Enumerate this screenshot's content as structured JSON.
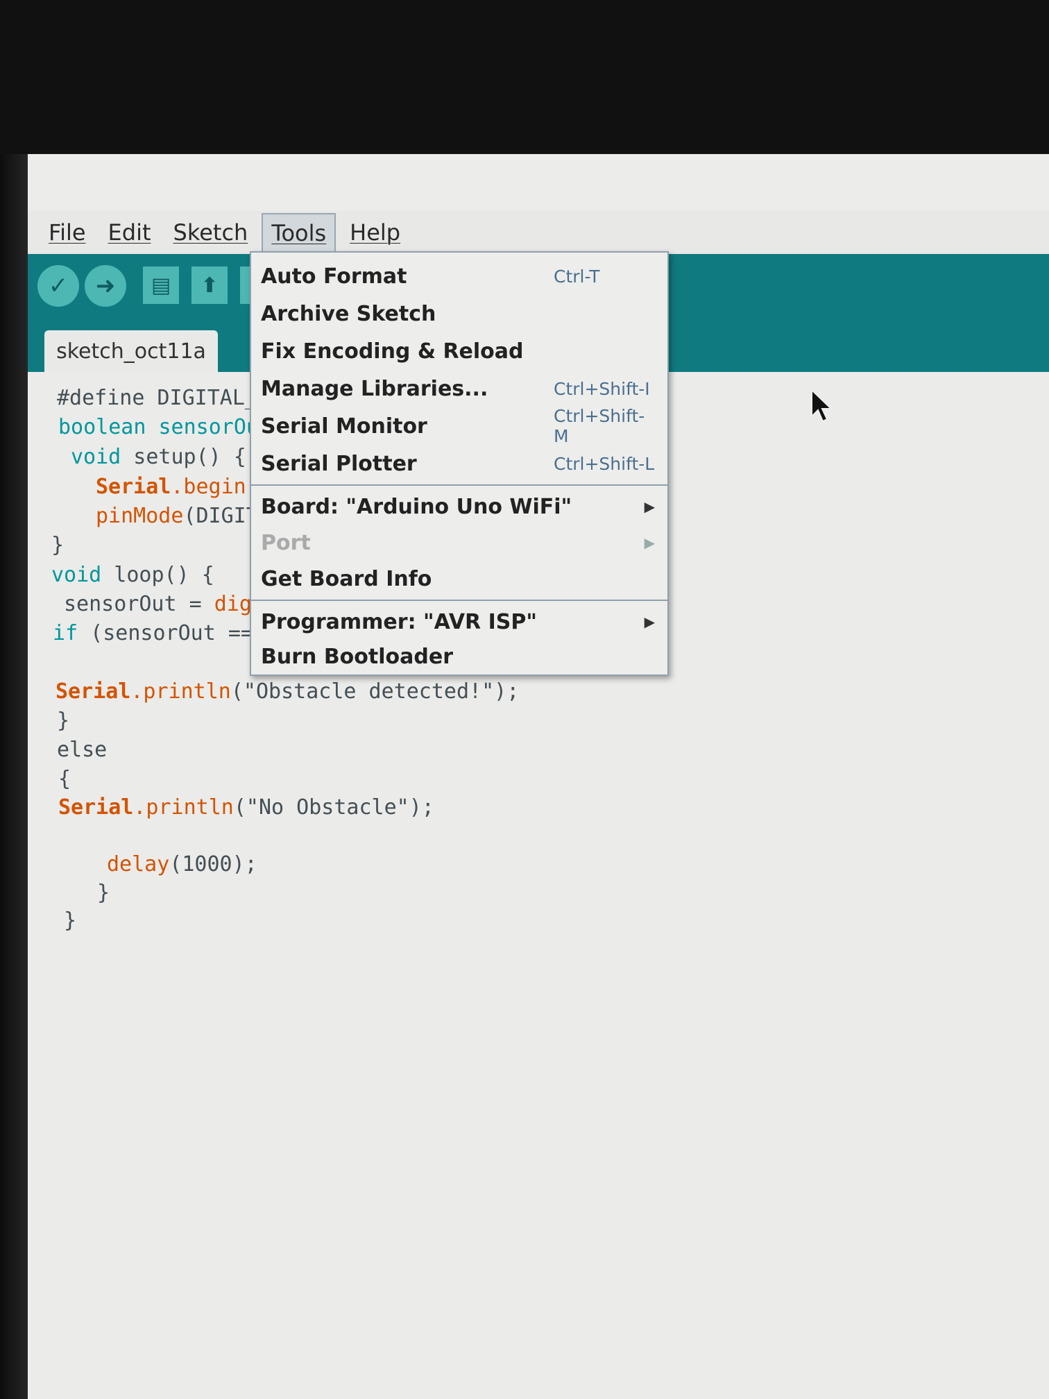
{
  "menubar": {
    "items": [
      {
        "label": "File"
      },
      {
        "label": "Edit"
      },
      {
        "label": "Sketch"
      },
      {
        "label": "Tools",
        "active": true
      },
      {
        "label": "Help"
      }
    ]
  },
  "toolbar": {
    "buttons": [
      {
        "name": "verify-icon"
      },
      {
        "name": "upload-icon"
      },
      {
        "name": "new-icon"
      },
      {
        "name": "open-icon"
      },
      {
        "name": "save-icon"
      }
    ]
  },
  "tab": {
    "label": "sketch_oct11a"
  },
  "code": {
    "line1": "#define DIGITAL_",
    "line2": "boolean sensorOu",
    "line3_a": "void",
    "line3_b": " setup() {",
    "line4_a": "Serial",
    "line4_b": ".begin(",
    "line5_a": "pinMode",
    "line5_b": "(DIGIT",
    "line6": "}",
    "line7_a": "void",
    "line7_b": " loop() {",
    "line8_a": "sensorOut = ",
    "line8_b": "digi",
    "line9_a": "if",
    "line9_b": " (sensorOut ==",
    "line10_a": "Serial",
    "line10_b": ".println",
    "line10_c": "(\"Obstacle detected!\");",
    "line11": "}",
    "line12": "else",
    "line13": "{",
    "line14_a": "Serial",
    "line14_b": ".println",
    "line14_c": "(\"No Obstacle\");",
    "line15_a": "delay",
    "line15_b": "(1000);",
    "line16": "}",
    "line17": "}"
  },
  "tools_menu": {
    "items": [
      {
        "label": "Auto Format",
        "shortcut": "Ctrl-T"
      },
      {
        "label": "Archive Sketch",
        "shortcut": ""
      },
      {
        "label": "Fix Encoding & Reload",
        "shortcut": ""
      },
      {
        "label": "Manage Libraries...",
        "shortcut": "Ctrl+Shift-I"
      },
      {
        "label": "Serial Monitor",
        "shortcut": "Ctrl+Shift-M"
      },
      {
        "label": "Serial Plotter",
        "shortcut": "Ctrl+Shift-L"
      },
      {
        "label": "Board: \"Arduino Uno WiFi\"",
        "submenu": true
      },
      {
        "label": "Port",
        "submenu": true,
        "disabled": true
      },
      {
        "label": "Get Board Info"
      },
      {
        "label": "Programmer: \"AVR ISP\"",
        "submenu": true
      },
      {
        "label": "Burn Bootloader"
      }
    ]
  },
  "colors": {
    "toolbar": "#0f7b80",
    "toolbar_button": "#4db7b4",
    "editor_bg": "#ebebea",
    "keyword": "#00979c",
    "function": "#d35400"
  }
}
